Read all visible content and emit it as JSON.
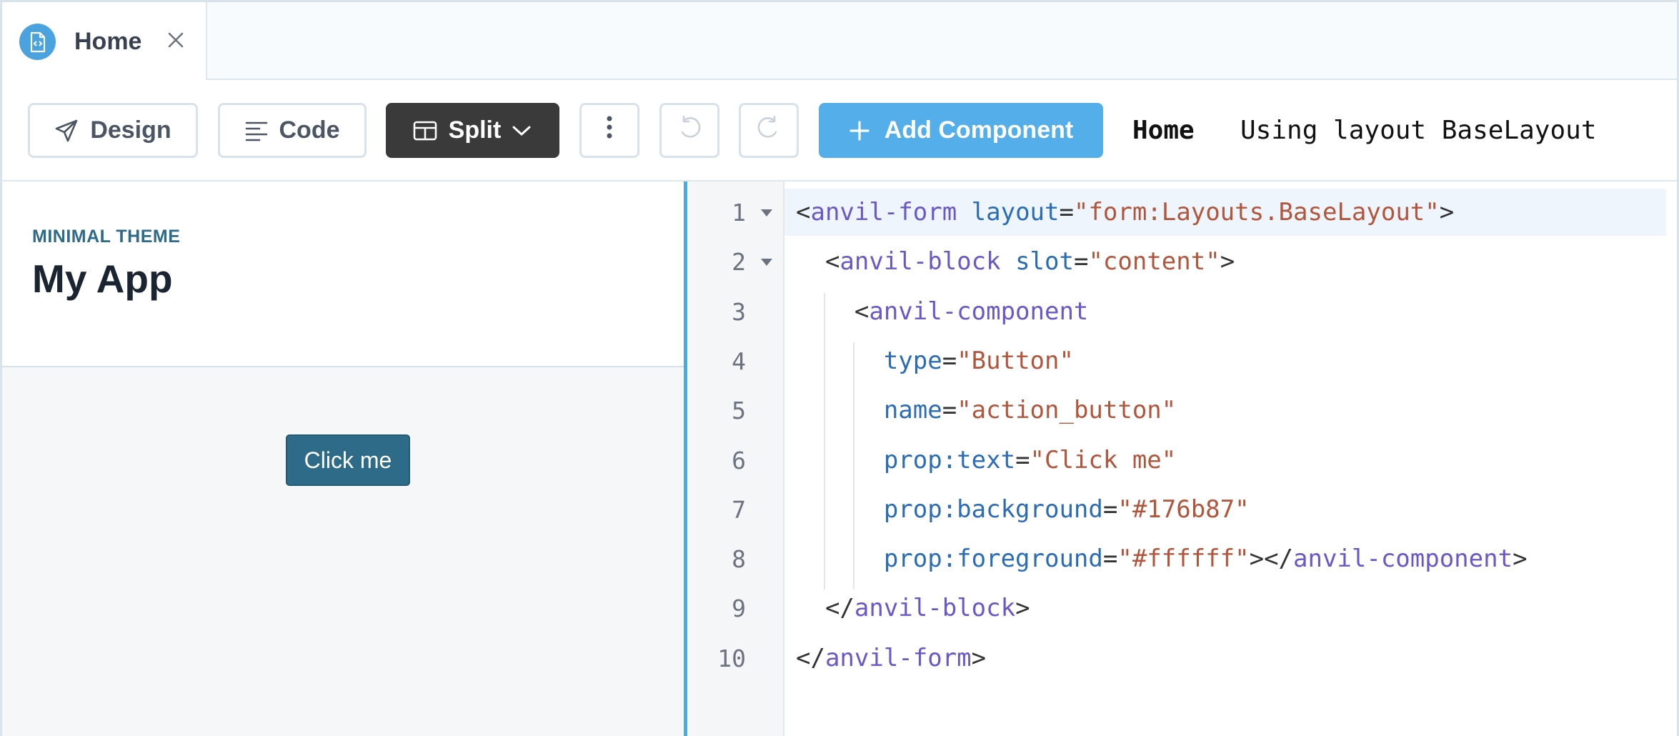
{
  "tab": {
    "title": "Home",
    "icon": "document-code-icon",
    "close_icon": "close-icon"
  },
  "toolbar": {
    "design_label": "Design",
    "code_label": "Code",
    "split_label": "Split",
    "add_component_label": "Add Component",
    "page_name": "Home",
    "layout_label": "Using layout BaseLayout"
  },
  "preview": {
    "theme_label": "MINIMAL THEME",
    "app_title": "My App",
    "button_label": "Click me",
    "button_color": "#176b87"
  },
  "editor": {
    "line_numbers": [
      "1",
      "2",
      "3",
      "4",
      "5",
      "6",
      "7",
      "8",
      "9",
      "10"
    ],
    "lines": [
      [
        [
          "pun",
          "<"
        ],
        [
          "tag",
          "anvil-form"
        ],
        [
          "pun",
          " "
        ],
        [
          "attr",
          "layout"
        ],
        [
          "pun",
          "="
        ],
        [
          "str",
          "\"form:Layouts.BaseLayout\""
        ],
        [
          "pun",
          ">"
        ]
      ],
      [
        [
          "pun",
          "  <"
        ],
        [
          "tag",
          "anvil-block"
        ],
        [
          "pun",
          " "
        ],
        [
          "attr",
          "slot"
        ],
        [
          "pun",
          "="
        ],
        [
          "str",
          "\"content\""
        ],
        [
          "pun",
          ">"
        ]
      ],
      [
        [
          "pun",
          "    <"
        ],
        [
          "tag",
          "anvil-component"
        ]
      ],
      [
        [
          "pun",
          "      "
        ],
        [
          "attr",
          "type"
        ],
        [
          "pun",
          "="
        ],
        [
          "str",
          "\"Button\""
        ]
      ],
      [
        [
          "pun",
          "      "
        ],
        [
          "attr",
          "name"
        ],
        [
          "pun",
          "="
        ],
        [
          "str",
          "\"action_button\""
        ]
      ],
      [
        [
          "pun",
          "      "
        ],
        [
          "attr",
          "prop:text"
        ],
        [
          "pun",
          "="
        ],
        [
          "str",
          "\"Click me\""
        ]
      ],
      [
        [
          "pun",
          "      "
        ],
        [
          "attr",
          "prop:background"
        ],
        [
          "pun",
          "="
        ],
        [
          "str",
          "\"#176b87\""
        ]
      ],
      [
        [
          "pun",
          "      "
        ],
        [
          "attr",
          "prop:foreground"
        ],
        [
          "pun",
          "="
        ],
        [
          "str",
          "\"#ffffff\""
        ],
        [
          "pun",
          "></"
        ],
        [
          "tag",
          "anvil-component"
        ],
        [
          "pun",
          ">"
        ]
      ],
      [
        [
          "pun",
          "  </"
        ],
        [
          "tag",
          "anvil-block"
        ],
        [
          "pun",
          ">"
        ]
      ],
      [
        [
          "pun",
          "</"
        ],
        [
          "tag",
          "anvil-form"
        ],
        [
          "pun",
          ">"
        ]
      ]
    ],
    "colors": {
      "tag": "#6a57c9",
      "attr": "#2a6cb8",
      "string": "#b2553b",
      "accent": "#4fa8e0"
    }
  }
}
